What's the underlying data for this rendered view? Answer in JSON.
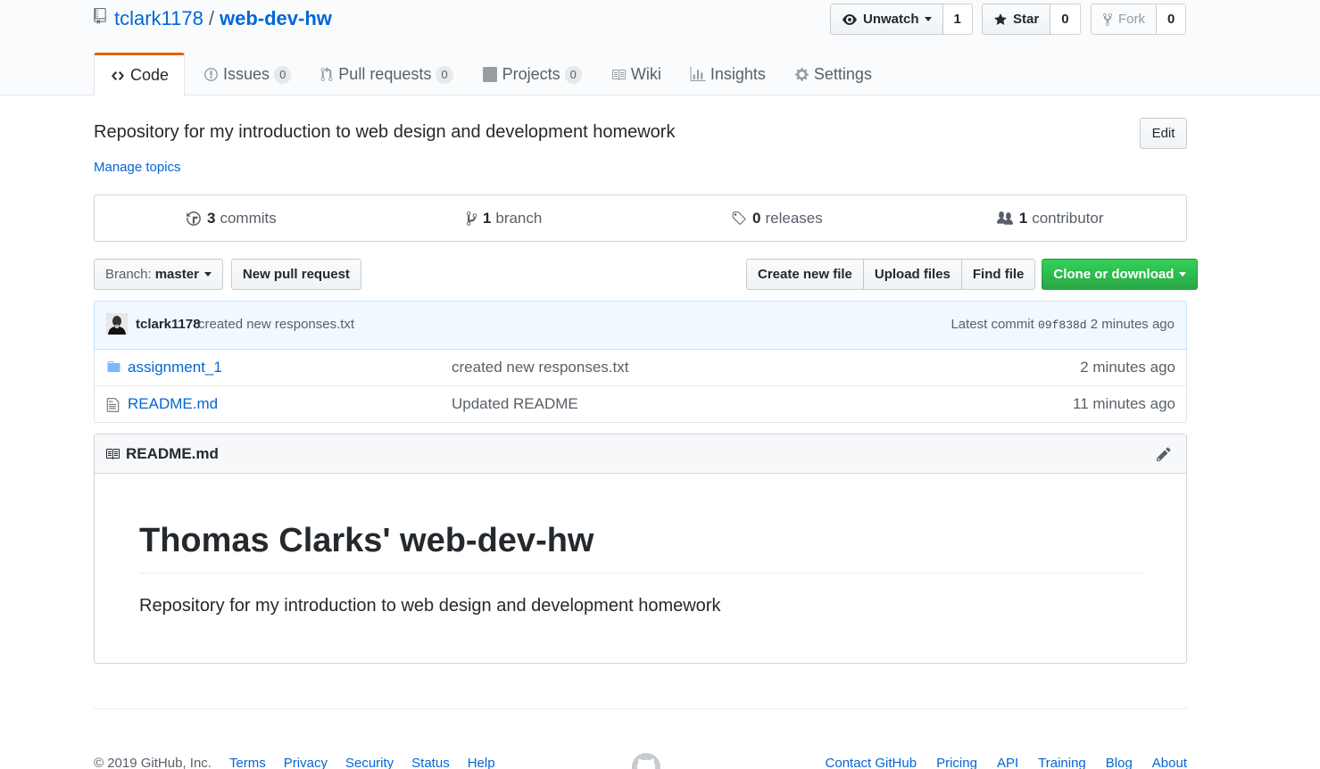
{
  "repo": {
    "owner": "tclark1178",
    "separator": "/",
    "name": "web-dev-hw"
  },
  "actions": {
    "watch": {
      "label": "Unwatch",
      "count": "1"
    },
    "star": {
      "label": "Star",
      "count": "0"
    },
    "fork": {
      "label": "Fork",
      "count": "0"
    }
  },
  "tabs": [
    {
      "label": "Code",
      "icon": "code-icon",
      "selected": true
    },
    {
      "label": "Issues",
      "icon": "issue-icon",
      "count": "0"
    },
    {
      "label": "Pull requests",
      "icon": "pull-request-icon",
      "count": "0"
    },
    {
      "label": "Projects",
      "icon": "project-icon",
      "count": "0"
    },
    {
      "label": "Wiki",
      "icon": "book-icon"
    },
    {
      "label": "Insights",
      "icon": "graph-icon"
    },
    {
      "label": "Settings",
      "icon": "gear-icon"
    }
  ],
  "description": "Repository for my introduction to web design and development homework",
  "edit_label": "Edit",
  "manage_topics": "Manage topics",
  "summary": {
    "commits": {
      "num": "3",
      "label": "commits"
    },
    "branches": {
      "num": "1",
      "label": "branch"
    },
    "releases": {
      "num": "0",
      "label": "releases"
    },
    "contributors": {
      "num": "1",
      "label": "contributor"
    }
  },
  "file_nav": {
    "branch_prefix": "Branch:",
    "branch": "master",
    "new_pr": "New pull request",
    "create_file": "Create new file",
    "upload": "Upload files",
    "find": "Find file",
    "clone": "Clone or download"
  },
  "latest_commit": {
    "author": "tclark1178",
    "message": "created new responses.txt",
    "prefix": "Latest commit",
    "sha": "09f838d",
    "age": "2 minutes ago"
  },
  "files": [
    {
      "type": "directory",
      "icon": "folder-icon",
      "name": "assignment_1",
      "message": "created new responses.txt",
      "age": "2 minutes ago"
    },
    {
      "type": "file",
      "icon": "file-icon",
      "name": "README.md",
      "message": "Updated README",
      "age": "11 minutes ago"
    }
  ],
  "readme": {
    "filename": "README.md",
    "heading": "Thomas Clarks' web-dev-hw",
    "body": "Repository for my introduction to web design and development homework"
  },
  "footer": {
    "copyright": "© 2019 GitHub, Inc.",
    "left_links": [
      "Terms",
      "Privacy",
      "Security",
      "Status",
      "Help"
    ],
    "right_links": [
      "Contact GitHub",
      "Pricing",
      "API",
      "Training",
      "Blog",
      "About"
    ]
  },
  "colors": {
    "link": "#0366d6",
    "accent_tab": "#e36209",
    "primary_button": "#28a745",
    "commit_bg": "#f1f8ff"
  }
}
